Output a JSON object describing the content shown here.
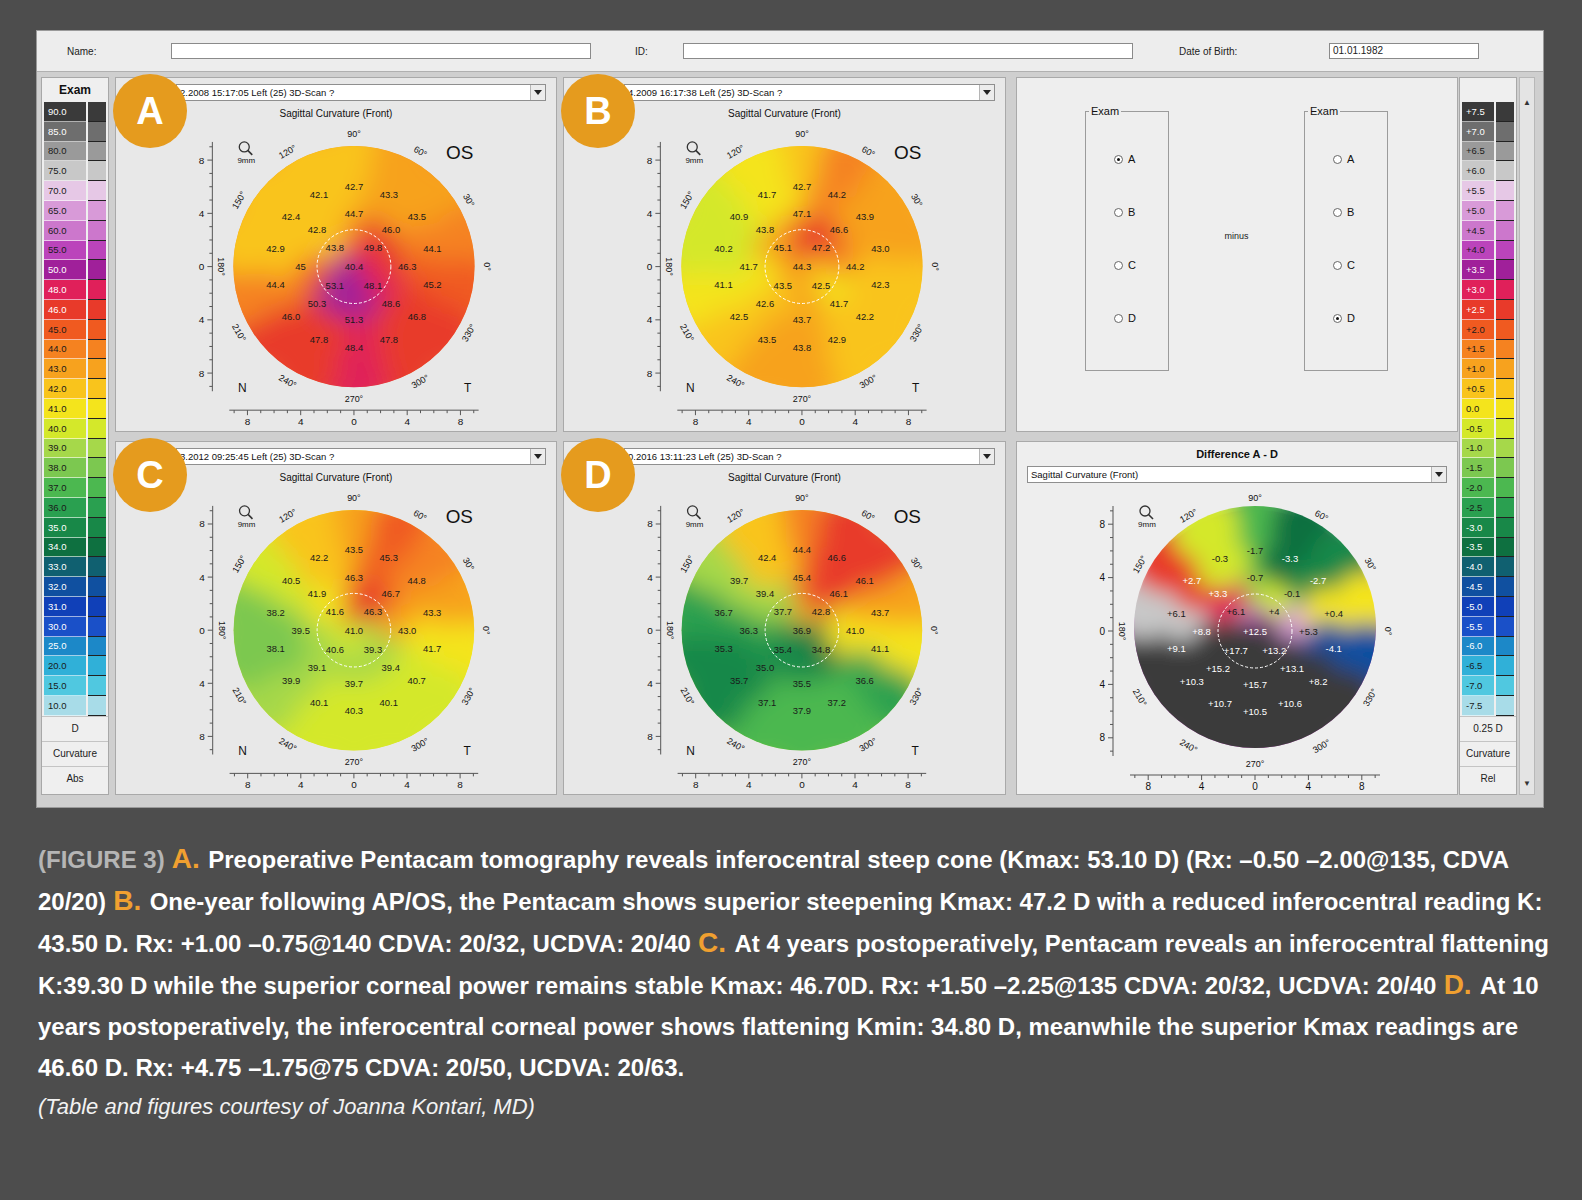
{
  "header": {
    "name_label": "Name:",
    "id_label": "ID:",
    "dob_label": "Date of Birth:",
    "dob_value": "01.01.1982"
  },
  "abs_scale": {
    "title": "Exam",
    "items": [
      {
        "value": "90.0",
        "color": "#3a3a3a"
      },
      {
        "value": "85.0",
        "color": "#6e6e6e"
      },
      {
        "value": "80.0",
        "color": "#9a9a9a"
      },
      {
        "value": "75.0",
        "color": "#c8c8c8"
      },
      {
        "value": "70.0",
        "color": "#e6c8e6"
      },
      {
        "value": "65.0",
        "color": "#d89ad8"
      },
      {
        "value": "60.0",
        "color": "#cc77cc"
      },
      {
        "value": "55.0",
        "color": "#bb44bb"
      },
      {
        "value": "50.0",
        "color": "#a0209a"
      },
      {
        "value": "48.0",
        "color": "#e0205a"
      },
      {
        "value": "46.0",
        "color": "#e83a2a"
      },
      {
        "value": "45.0",
        "color": "#f05a20"
      },
      {
        "value": "44.0",
        "color": "#f58220"
      },
      {
        "value": "43.0",
        "color": "#f7a21e"
      },
      {
        "value": "42.0",
        "color": "#f9c41c"
      },
      {
        "value": "41.0",
        "color": "#f4e41c"
      },
      {
        "value": "40.0",
        "color": "#d4e82a"
      },
      {
        "value": "39.0",
        "color": "#a6d84a"
      },
      {
        "value": "38.0",
        "color": "#7cc850"
      },
      {
        "value": "37.0",
        "color": "#4cb850"
      },
      {
        "value": "36.0",
        "color": "#2aa050"
      },
      {
        "value": "35.0",
        "color": "#188848"
      },
      {
        "value": "34.0",
        "color": "#0e7040"
      },
      {
        "value": "33.0",
        "color": "#106070"
      },
      {
        "value": "32.0",
        "color": "#1050a0"
      },
      {
        "value": "31.0",
        "color": "#1040b8"
      },
      {
        "value": "30.0",
        "color": "#1a50c8"
      },
      {
        "value": "25.0",
        "color": "#1c88c8"
      },
      {
        "value": "20.0",
        "color": "#30b0d8"
      },
      {
        "value": "15.0",
        "color": "#50c8e0"
      },
      {
        "value": "10.0",
        "color": "#a8dce8"
      }
    ],
    "footer": [
      "D",
      "Curvature",
      "Abs"
    ]
  },
  "rel_scale": {
    "scroll_up": "▲",
    "scroll_down": "▼",
    "items": [
      {
        "value": "+7.5",
        "color": "#3a3a3a"
      },
      {
        "value": "+7.0",
        "color": "#6e6e6e"
      },
      {
        "value": "+6.5",
        "color": "#9a9a9a"
      },
      {
        "value": "+6.0",
        "color": "#c8c8c8"
      },
      {
        "value": "+5.5",
        "color": "#e6c8e6"
      },
      {
        "value": "+5.0",
        "color": "#d89ad8"
      },
      {
        "value": "+4.5",
        "color": "#cc77cc"
      },
      {
        "value": "+4.0",
        "color": "#bb44bb"
      },
      {
        "value": "+3.5",
        "color": "#a0209a"
      },
      {
        "value": "+3.0",
        "color": "#e0205a"
      },
      {
        "value": "+2.5",
        "color": "#e83a2a"
      },
      {
        "value": "+2.0",
        "color": "#f05a20"
      },
      {
        "value": "+1.5",
        "color": "#f58220"
      },
      {
        "value": "+1.0",
        "color": "#f7a21e"
      },
      {
        "value": "+0.5",
        "color": "#f9c41c"
      },
      {
        "value": "0.0",
        "color": "#f4e41c"
      },
      {
        "value": "-0.5",
        "color": "#d4e82a"
      },
      {
        "value": "-1.0",
        "color": "#a6d84a"
      },
      {
        "value": "-1.5",
        "color": "#7cc850"
      },
      {
        "value": "-2.0",
        "color": "#4cb850"
      },
      {
        "value": "-2.5",
        "color": "#2aa050"
      },
      {
        "value": "-3.0",
        "color": "#188848"
      },
      {
        "value": "-3.5",
        "color": "#0e7040"
      },
      {
        "value": "-4.0",
        "color": "#106070"
      },
      {
        "value": "-4.5",
        "color": "#1050a0"
      },
      {
        "value": "-5.0",
        "color": "#1040b8"
      },
      {
        "value": "-5.5",
        "color": "#1a50c8"
      },
      {
        "value": "-6.0",
        "color": "#1c88c8"
      },
      {
        "value": "-6.5",
        "color": "#30b0d8"
      },
      {
        "value": "-7.0",
        "color": "#50c8e0"
      },
      {
        "value": "-7.5",
        "color": "#a8dce8"
      }
    ],
    "footer": [
      "0.25 D",
      "Curvature",
      "Rel"
    ]
  },
  "map_common": {
    "view": "Sagittal Curvature (Front)",
    "zoom": "9mm",
    "eye": "OS",
    "nasal": "N",
    "temporal": "T",
    "degrees": [
      "90°",
      "60°",
      "30°",
      "0°",
      "330°",
      "300°",
      "270°",
      "240°",
      "210°",
      "180°",
      "150°",
      "120°"
    ],
    "axis_ticks": [
      "8",
      "4",
      "0",
      "4",
      "8"
    ]
  },
  "maps": [
    {
      "badge": "A",
      "scan": "2.2008 15:17:05 Left (25) 3D-Scan ?",
      "values": [
        "40.4",
        "43.8",
        "49.8",
        "48.1",
        "53.1",
        "44.7",
        "46.0",
        "46.3",
        "48.6",
        "51.3",
        "50.3",
        "45",
        "42.8",
        "42.7",
        "43.3",
        "43.5",
        "44.1",
        "45.2",
        "46.8",
        "47.8",
        "48.4",
        "47.8",
        "46.0",
        "44.4",
        "42.9",
        "42.4",
        "42.1"
      ]
    },
    {
      "badge": "B",
      "scan": "4.2009 16:17:38 Left (25) 3D-Scan ?",
      "values": [
        "44.3",
        "45.1",
        "47.2",
        "42.5",
        "43.5",
        "47.1",
        "46.6",
        "44.2",
        "41.7",
        "43.7",
        "42.6",
        "41.7",
        "43.8",
        "42.7",
        "44.2",
        "43.9",
        "43.0",
        "42.3",
        "42.2",
        "42.9",
        "43.8",
        "43.5",
        "42.5",
        "41.1",
        "40.2",
        "40.9",
        "41.7"
      ]
    },
    {
      "badge": "C",
      "scan": "3.2012 09:25:45 Left (25) 3D-Scan ?",
      "values": [
        "41.0",
        "41.6",
        "46.3",
        "39.3",
        "40.6",
        "46.3",
        "46.7",
        "43.0",
        "39.4",
        "39.7",
        "39.1",
        "39.5",
        "41.9",
        "43.5",
        "45.3",
        "44.8",
        "43.3",
        "41.7",
        "40.7",
        "40.1",
        "40.3",
        "40.1",
        "39.9",
        "38.1",
        "38.2",
        "40.5",
        "42.2"
      ]
    },
    {
      "badge": "D",
      "scan": "0.2016 13:11:23 Left (25) 3D-Scan ?",
      "values": [
        "36.9",
        "37.7",
        "42.8",
        "34.8",
        "35.4",
        "45.4",
        "46.1",
        "41.0",
        "35.5",
        "35.0",
        "36.3",
        "39.4",
        "44.4",
        "46.6",
        "46.1",
        "43.7",
        "41.1",
        "36.6",
        "37.2",
        "37.9",
        "37.1",
        "35.7",
        "35.3",
        "36.7",
        "39.7",
        "42.4"
      ]
    }
  ],
  "compare": {
    "left_title": "Exam",
    "right_title": "Exam",
    "operator": "minus",
    "left_options": [
      {
        "label": "A",
        "selected": true
      },
      {
        "label": "B",
        "selected": false
      },
      {
        "label": "C",
        "selected": false
      },
      {
        "label": "D",
        "selected": false
      }
    ],
    "right_options": [
      {
        "label": "A",
        "selected": false
      },
      {
        "label": "B",
        "selected": false
      },
      {
        "label": "C",
        "selected": false
      },
      {
        "label": "D",
        "selected": true
      }
    ],
    "title": "Difference A - D",
    "view": "Sagittal Curvature (Front)",
    "zoom": "9mm",
    "values": [
      "+12.5",
      "+6.1",
      "+4",
      "+13.2",
      "+17.7",
      "-0.7",
      "-0.1",
      "+5.3",
      "+13.1",
      "+15.7",
      "+15.2",
      "+8.8",
      "+3.3",
      "-1.7",
      "-3.3",
      "-2.7",
      "+0.4",
      "-4.1",
      "+8.2",
      "+10.6",
      "+10.5",
      "+10.7",
      "+10.3",
      "+9.1",
      "+6.1",
      "+2.7",
      "-0.3"
    ]
  },
  "caption": {
    "segments": [
      {
        "kind": "figure",
        "text": "(FIGURE 3)"
      },
      {
        "kind": "letter",
        "text": "A."
      },
      {
        "kind": "body",
        "text": "Preoperative Pentacam tomography reveals inferocentral steep cone (Kmax: 53.10 D) (Rx: –0.50 –2.00@135, CDVA 20/20)"
      },
      {
        "kind": "letter",
        "text": "B."
      },
      {
        "kind": "body",
        "text": "One-year following AP/OS, the Pentacam shows superior steepening Kmax: 47.2 D with a reduced inferocentral reading K: 43.50 D. Rx: +1.00 –0.75@140 CDVA: 20/32, UCDVA: 20/40"
      },
      {
        "kind": "letter",
        "text": "C."
      },
      {
        "kind": "body",
        "text": "At 4 years postoperatively, Pentacam reveals an inferocentral flattening K:39.30 D while the superior corneal power remains stable Kmax: 46.70D. Rx: +1.50 –2.25@135 CDVA: 20/32, UCDVA: 20/40"
      },
      {
        "kind": "letter",
        "text": "D."
      },
      {
        "kind": "body",
        "text": "At 10 years postoperatively, the inferocentral corneal power shows flattening Kmin: 34.80 D, meanwhile the superior Kmax readings are 46.60 D. Rx: +4.75 –1.75@75 CDVA: 20/50, UCDVA: 20/63."
      }
    ],
    "credit": "(Table and figures courtesy of Joanna Kontari, MD)"
  }
}
